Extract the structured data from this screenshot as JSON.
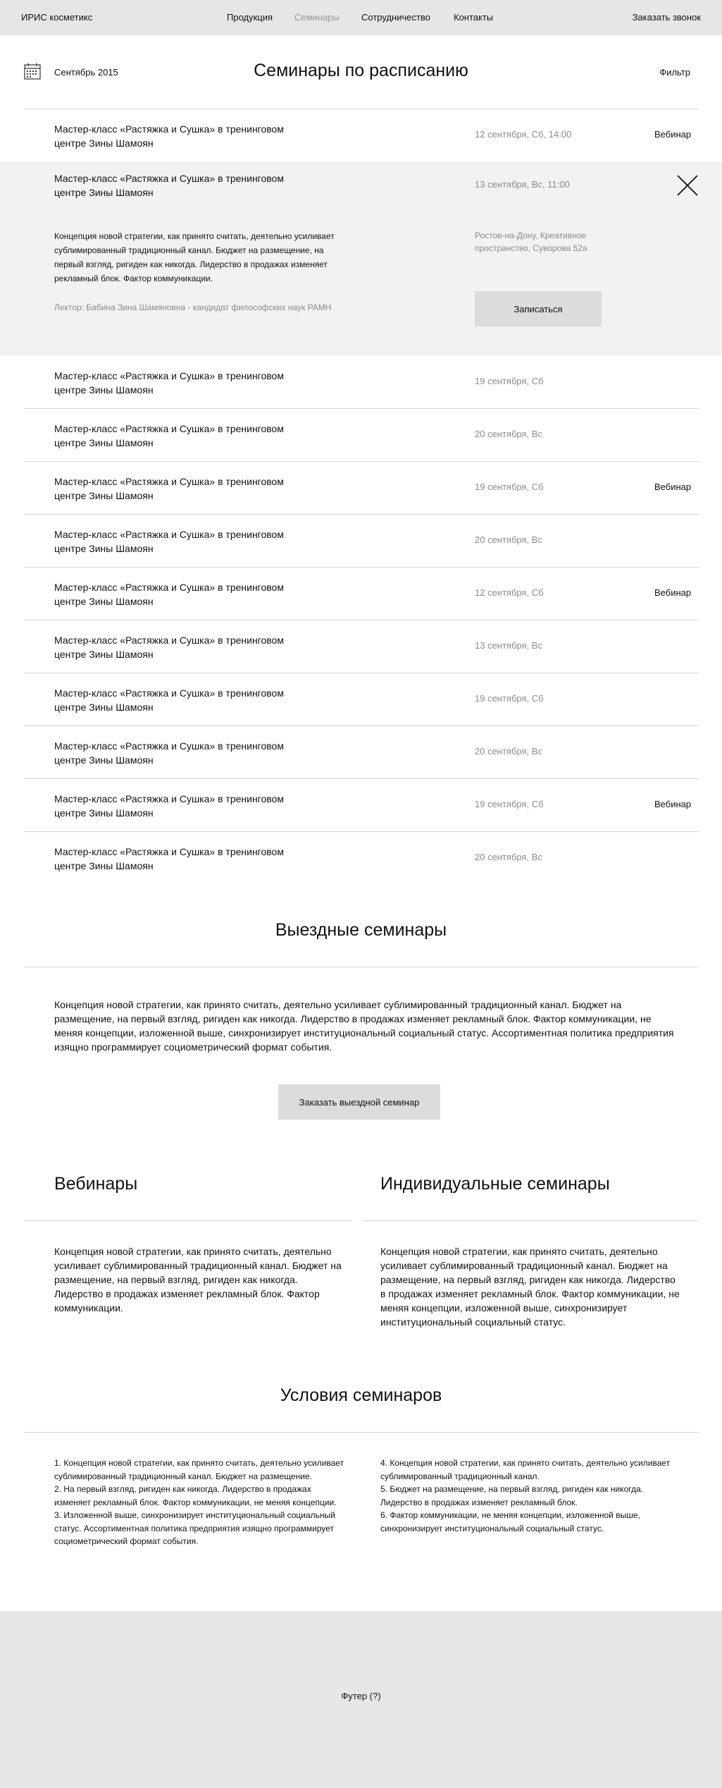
{
  "header": {
    "logo": "ИРИС косметикс",
    "nav": [
      {
        "label": "Продукция"
      },
      {
        "label": "Семинары",
        "active": true
      },
      {
        "label": "Сотрудничество"
      },
      {
        "label": "Контакты"
      }
    ],
    "callback": "Заказать звонок"
  },
  "schedule": {
    "month": "Сентябрь 2015",
    "title": "Семинары по расписанию",
    "filter": "Фильтр",
    "rows": [
      {
        "name": "Мастер-класс «Растяжка и Сушка» в тренинговом центре Зины Шамоян",
        "date": "12 сентября, Сб, 14:00",
        "tag": "Вебинар"
      },
      {
        "name": "Мастер-класс «Растяжка и Сушка» в тренинговом центре Зины Шамоян",
        "date": "19 сентября, Сб",
        "tag": ""
      },
      {
        "name": "Мастер-класс «Растяжка и Сушка» в тренинговом центре Зины Шамоян",
        "date": "20 сентября, Вс",
        "tag": ""
      },
      {
        "name": "Мастер-класс «Растяжка и Сушка» в тренинговом центре Зины Шамоян",
        "date": "19 сентября, Сб",
        "tag": "Вебинар"
      },
      {
        "name": "Мастер-класс «Растяжка и Сушка» в тренинговом центре Зины Шамоян",
        "date": "20 сентября, Вс",
        "tag": ""
      },
      {
        "name": "Мастер-класс «Растяжка и Сушка» в тренинговом центре Зины Шамоян",
        "date": "12 сентября, Сб",
        "tag": "Вебинар"
      },
      {
        "name": "Мастер-класс «Растяжка и Сушка» в тренинговом центре Зины Шамоян",
        "date": "13 сентября, Вс",
        "tag": ""
      },
      {
        "name": "Мастер-класс «Растяжка и Сушка» в тренинговом центре Зины Шамоян",
        "date": "19 сентября, Сб",
        "tag": ""
      },
      {
        "name": "Мастер-класс «Растяжка и Сушка» в тренинговом центре Зины Шамоян",
        "date": "20 сентября, Вс",
        "tag": ""
      },
      {
        "name": "Мастер-класс «Растяжка и Сушка» в тренинговом центре Зины Шамоян",
        "date": "19 сентября, Сб",
        "tag": "Вебинар"
      },
      {
        "name": "Мастер-класс «Растяжка и Сушка» в тренинговом центре Зины Шамоян",
        "date": "20 сентября, Вс",
        "tag": ""
      }
    ],
    "expanded": {
      "name": "Мастер-класс «Растяжка и Сушка» в тренинговом центре Зины Шамоян",
      "date": "13 сентября, Вс, 11:00",
      "description": "Концепция новой стратегии, как принято считать, деятельно усиливает сублимированный традиционный канал. Бюджет на размещение, на первый взгляд, ригиден как никогда. Лидерство в продажах изменяет рекламный блок. Фактор коммуникации.",
      "lector": "Лектор: Бабина Зина Шамяновна - кандидат философских наук РАМН",
      "address": "Ростов-на-Дону, Креативное пространство, Суворова 52а",
      "signup": "Записаться"
    }
  },
  "outdoor": {
    "title": "Выездные семинары",
    "text": "Концепция новой стратегии, как принято считать, деятельно усиливает сублимированный традиционный канал. Бюджет на размещение, на первый взгляд, ригиден как никогда. Лидерство в продажах изменяет рекламный блок. Фактор коммуникации, не меняя концепции, изложенной выше, синхронизирует институциональный социальный статус. Ассортиментная политика предприятия изящно программирует социометрический формат события.",
    "button": "Заказать выездной семинар"
  },
  "webinars": {
    "title": "Вебинары",
    "text": "Концепция новой стратегии, как принято считать, деятельно усиливает сублимированный традиционный канал. Бюджет на размещение, на первый взгляд, ригиден как никогда. Лидерство в продажах изменяет рекламный блок. Фактор коммуникации."
  },
  "individual": {
    "title": "Индивидуальные семинары",
    "text": "Концепция новой стратегии, как принято считать, деятельно усиливает сублимированный традиционный канал. Бюджет на размещение, на первый взгляд, ригиден как никогда. Лидерство в продажах изменяет рекламный блок. Фактор коммуникации, не меняя концепции, изложенной выше, синхронизирует институциональный социальный статус."
  },
  "conditions": {
    "title": "Условия семинаров",
    "left": [
      "1. Концепция новой стратегии, как принято считать, деятельно усиливает сублимированный традиционный канал. Бюджет на размещение.",
      "2. На первый взгляд, ригиден как никогда. Лидерство в продажах изменяет рекламный блок. Фактор коммуникации, не меняя концепции.",
      "3. Изложенной выше, синхронизирует институциональный социальный статус. Ассортиментная политика предприятия изящно программирует социометрический формат события."
    ],
    "right": [
      "4. Концепция новой стратегии, как принято считать, деятельно усиливает сублимированный традиционный канал.",
      "5. Бюджет на размещение, на первый взгляд, ригиден как никогда. Лидерство в продажах изменяет рекламный блок.",
      "6. Фактор коммуникации, не меняя концепции, изложенной выше, синхронизирует институциональный социальный статус."
    ]
  },
  "footer": {
    "label": "Футер (?)"
  },
  "icons": {
    "calendar": "calendar-icon",
    "close": "close-icon"
  }
}
